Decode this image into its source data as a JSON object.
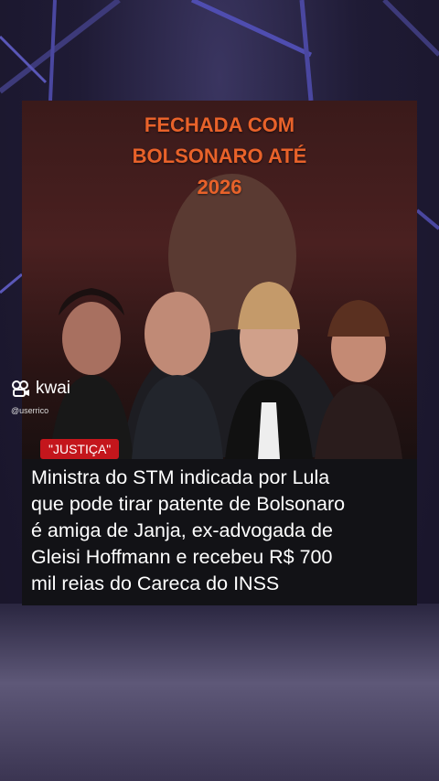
{
  "headline": {
    "lines": [
      "FECHADA COM",
      "BOLSONARO ATÉ",
      "2026"
    ]
  },
  "tag": "\"JUSTIÇA\"",
  "caption": {
    "lines": [
      "Ministra do STM indicada por Lula",
      "que pode tirar patente de Bolsonaro",
      "é amiga de Janja, ex-advogada de",
      "Gleisi Hoffmann e recebeu R$ 700",
      "mil reias do Careca do INSS"
    ]
  },
  "watermark": {
    "brand": "kwai",
    "user": "@userrico",
    "icon": "kwai-logo-icon"
  },
  "colors": {
    "headline": "#e8622a",
    "tag_bg": "#c4161c",
    "background": "#1f1b35"
  }
}
